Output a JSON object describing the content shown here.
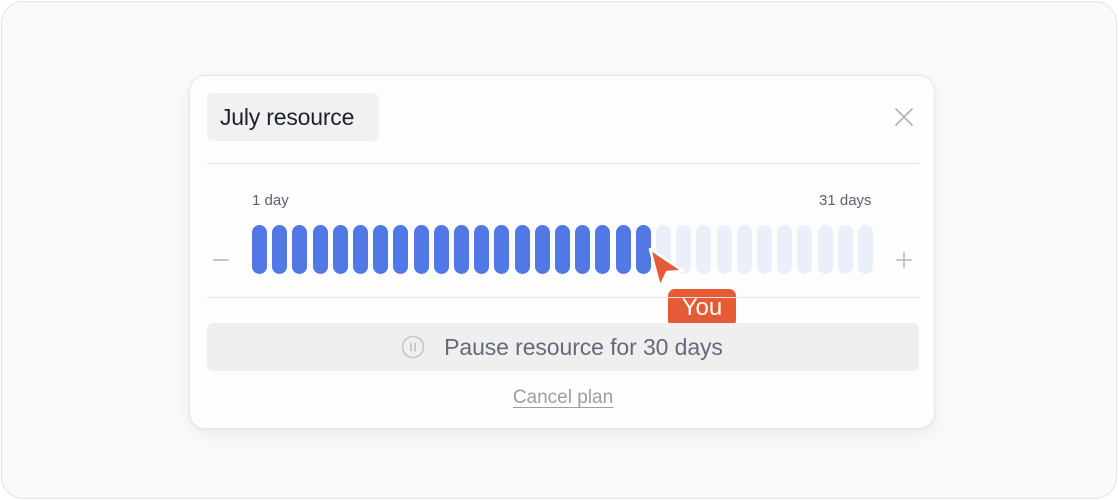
{
  "dialog": {
    "title": "July resource",
    "close_icon": "close-icon"
  },
  "slider": {
    "min_label": "1 day",
    "max_label": "31 days",
    "total_days": 31,
    "selected_days": 20,
    "active_color": "#5178e5",
    "inactive_color": "#eaeff9",
    "decrement_icon": "minus-icon",
    "increment_icon": "plus-icon"
  },
  "pointer": {
    "label": "You",
    "color": "#e65a35",
    "icon": "cursor-arrow-icon"
  },
  "actions": {
    "pause_label": "Pause resource for 30 days",
    "pause_icon": "pause-circle-icon",
    "cancel_label": "Cancel plan"
  }
}
